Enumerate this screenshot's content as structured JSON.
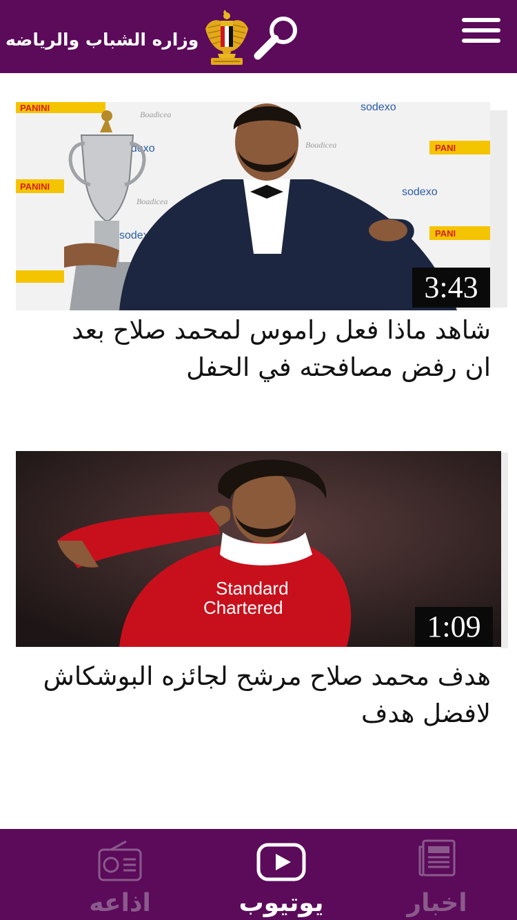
{
  "header": {
    "title": "وزاره الشباب والرياضه",
    "emblem_icon": "egypt-eagle-emblem-icon",
    "search_icon": "search-icon",
    "menu_icon": "menu-icon",
    "bar_color": "#5b0b5a"
  },
  "videos": [
    {
      "duration": "3:43",
      "caption": "شاهد ماذا فعل راموس لمحمد صلاح بعد ان رفض مصافحته في الحفل",
      "thumbnail": "player-in-tuxedo-with-trophy"
    },
    {
      "duration": "1:09",
      "caption": "هدف محمد صلاح مرشح لجائزه البوشكاش لافضل هدف",
      "thumbnail": "player-in-red-kit-celebrating"
    }
  ],
  "tabbar": {
    "tabs": [
      {
        "label": "اذاعه",
        "icon": "radio-icon",
        "active": false
      },
      {
        "label": "يوتيوب",
        "icon": "youtube-play-icon",
        "active": true
      },
      {
        "label": "اخبار",
        "icon": "newspaper-icon",
        "active": false
      }
    ],
    "active_color": "#ffffff",
    "inactive_color": "#8b5a8c"
  }
}
